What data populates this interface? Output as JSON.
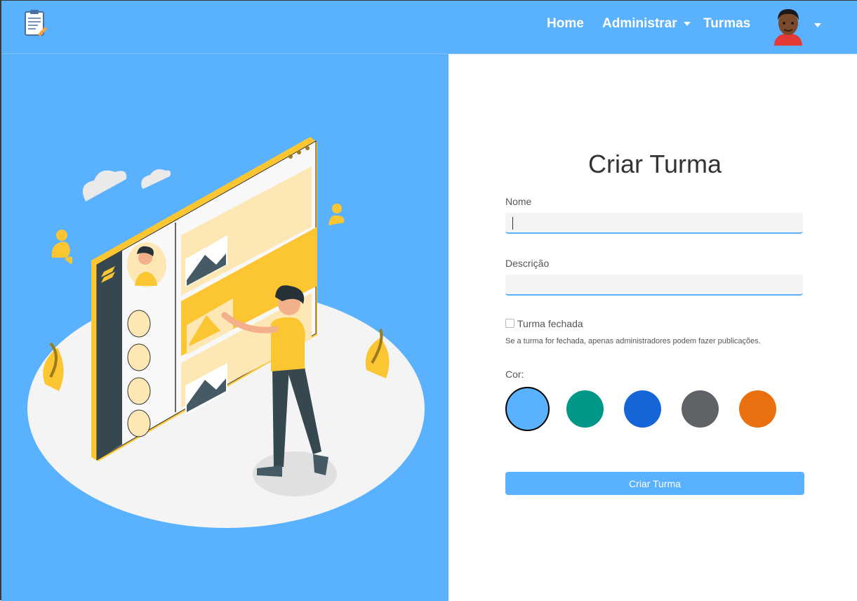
{
  "nav": {
    "home": "Home",
    "admin": "Administrar",
    "classes": "Turmas"
  },
  "form": {
    "title": "Criar Turma",
    "name_label": "Nome",
    "name_value": "",
    "description_label": "Descrição",
    "description_value": "",
    "closed_label": "Turma fechada",
    "closed_checked": false,
    "closed_hint": "Se a turma for fechada, apenas administradores podem fazer publicações.",
    "color_label": "Cor:",
    "colors": [
      "#5ab2ff",
      "#009688",
      "#1565d8",
      "#5f6368",
      "#ea6f0f"
    ],
    "selected_color": "#5ab2ff",
    "submit_label": "Criar Turma"
  },
  "theme": {
    "primary": "#5ab2ff",
    "accent_yellow": "#fcc632"
  }
}
